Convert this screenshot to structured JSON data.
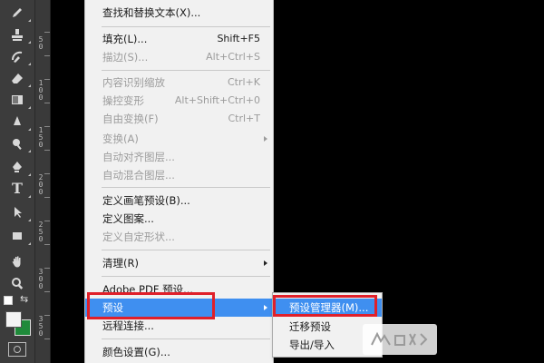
{
  "menu": {
    "items": [
      {
        "label": "查找和替换文本(X)...",
        "shortcut": "",
        "disabled": false
      },
      {
        "label": "填充(L)...",
        "shortcut": "Shift+F5",
        "disabled": false
      },
      {
        "label": "描边(S)...",
        "shortcut": "Alt+Ctrl+S",
        "disabled": true
      },
      {
        "label": "内容识别缩放",
        "shortcut": "Ctrl+K",
        "disabled": true
      },
      {
        "label": "操控变形",
        "shortcut": "Alt+Shift+Ctrl+0",
        "disabled": true
      },
      {
        "label": "自由变换(F)",
        "shortcut": "Ctrl+T",
        "disabled": true
      },
      {
        "label": "变换(A)",
        "shortcut": "",
        "disabled": true,
        "submenu": true
      },
      {
        "label": "自动对齐图层...",
        "shortcut": "",
        "disabled": true
      },
      {
        "label": "自动混合图层...",
        "shortcut": "",
        "disabled": true
      },
      {
        "label": "定义画笔预设(B)...",
        "shortcut": "",
        "disabled": false
      },
      {
        "label": "定义图案...",
        "shortcut": "",
        "disabled": false
      },
      {
        "label": "定义自定形状...",
        "shortcut": "",
        "disabled": true
      },
      {
        "label": "清理(R)",
        "shortcut": "",
        "disabled": false,
        "submenu": true
      },
      {
        "label": "Adobe PDF 预设...",
        "shortcut": "",
        "disabled": false
      },
      {
        "label": "预设",
        "shortcut": "",
        "disabled": false,
        "submenu": true,
        "highlighted": true
      },
      {
        "label": "远程连接...",
        "shortcut": "",
        "disabled": false
      },
      {
        "label": "颜色设置(G)...",
        "shortcut": "",
        "disabled": false
      }
    ]
  },
  "submenu": {
    "items": [
      {
        "label": "预设管理器(M)...",
        "highlighted": true
      },
      {
        "label": "迁移预设",
        "highlighted": false
      },
      {
        "label": "导出/导入",
        "highlighted": false
      }
    ]
  },
  "ruler": {
    "ticks": [
      "5\n0",
      "1\n0\n0",
      "1\n5\n0",
      "2\n0\n0",
      "2\n5\n0",
      "3\n0\n0",
      "3\n5\n0"
    ]
  },
  "toolbar": {
    "tools": [
      "pencil-icon",
      "stamp-icon",
      "history-brush-icon",
      "eraser-icon",
      "gradient-icon",
      "blur-icon",
      "dodge-icon",
      "pen-icon",
      "text-icon",
      "path-select-icon",
      "rectangle-shape-icon",
      "hand-icon",
      "zoom-icon"
    ],
    "glyphs": [
      "✎",
      "⊥",
      "⟲",
      "▱",
      "▭",
      "▲",
      "●",
      "✒",
      "T",
      "➤",
      "▬",
      "✋",
      "⚲"
    ],
    "text_tool_glyph": "T"
  },
  "colors": {
    "accent": "#3f8ff0",
    "callout": "#e0202a",
    "background_swatch": "#1f8a3a",
    "foreground_swatch": "#f4f4f4"
  }
}
